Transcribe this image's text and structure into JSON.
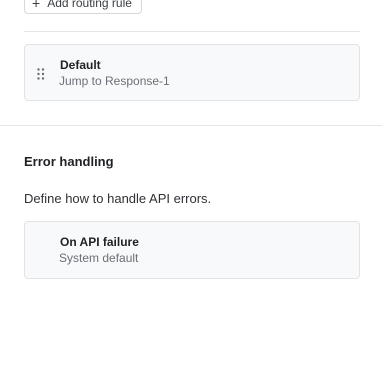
{
  "routing": {
    "add_rule_label": "Add routing rule",
    "default_card": {
      "title": "Default",
      "subtitle": "Jump to Response-1"
    }
  },
  "error_handling": {
    "title": "Error handling",
    "description": "Define how to handle API errors.",
    "failure_card": {
      "title": "On API failure",
      "subtitle": "System default"
    }
  },
  "icons": {
    "add": "plus-icon",
    "drag": "drag-handle-icon"
  }
}
